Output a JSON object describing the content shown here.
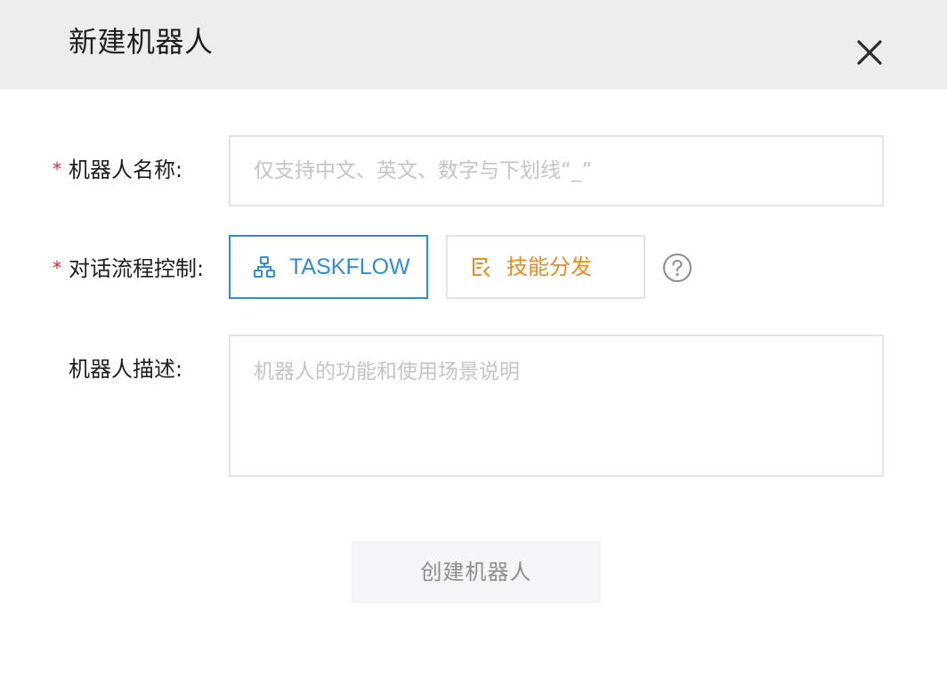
{
  "dialog": {
    "title": "新建机器人",
    "close_icon": "close-icon"
  },
  "form": {
    "name": {
      "required_mark": "*",
      "label": "机器人名称:",
      "value": "",
      "placeholder": "仅支持中文、英文、数字与下划线“_”"
    },
    "flow_control": {
      "required_mark": "*",
      "label": "对话流程控制:",
      "options": [
        {
          "label": "TASKFLOW",
          "icon": "flow-tree-icon",
          "selected": true,
          "color": "#2e8ddb"
        },
        {
          "label": "技能分发",
          "icon": "skill-dispatch-icon",
          "selected": false,
          "color": "#ef8a1d"
        }
      ],
      "help_icon": "question-circle-icon"
    },
    "description": {
      "label": "机器人描述:",
      "value": "",
      "placeholder": "机器人的功能和使用场景说明"
    }
  },
  "actions": {
    "submit_label": "创建机器人"
  },
  "colors": {
    "header_bg": "#ededed",
    "required": "#e5242b",
    "primary": "#2e8ddb",
    "accent": "#ef8a1d",
    "border": "#e3e3e3",
    "button_bg": "#f4f5f8"
  }
}
